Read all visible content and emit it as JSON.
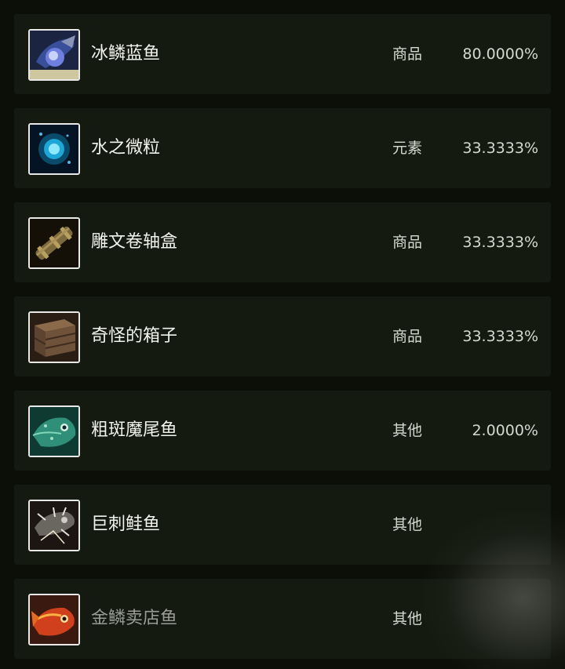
{
  "items": [
    {
      "name": "冰鳞蓝鱼",
      "type": "商品",
      "rate": "80.0000%",
      "icon": "blue-fish-icon"
    },
    {
      "name": "水之微粒",
      "type": "元素",
      "rate": "33.3333%",
      "icon": "water-particle-icon"
    },
    {
      "name": "雕文卷轴盒",
      "type": "商品",
      "rate": "33.3333%",
      "icon": "scroll-case-icon"
    },
    {
      "name": "奇怪的箱子",
      "type": "商品",
      "rate": "33.3333%",
      "icon": "wooden-crate-icon"
    },
    {
      "name": "粗斑魔尾鱼",
      "type": "其他",
      "rate": "2.0000%",
      "icon": "green-fish-icon"
    },
    {
      "name": "巨刺鲑鱼",
      "type": "其他",
      "rate": "",
      "icon": "spiny-fish-icon"
    },
    {
      "name": "金鳞卖店鱼",
      "type": "其他",
      "rate": "",
      "icon": "red-fish-icon"
    }
  ]
}
